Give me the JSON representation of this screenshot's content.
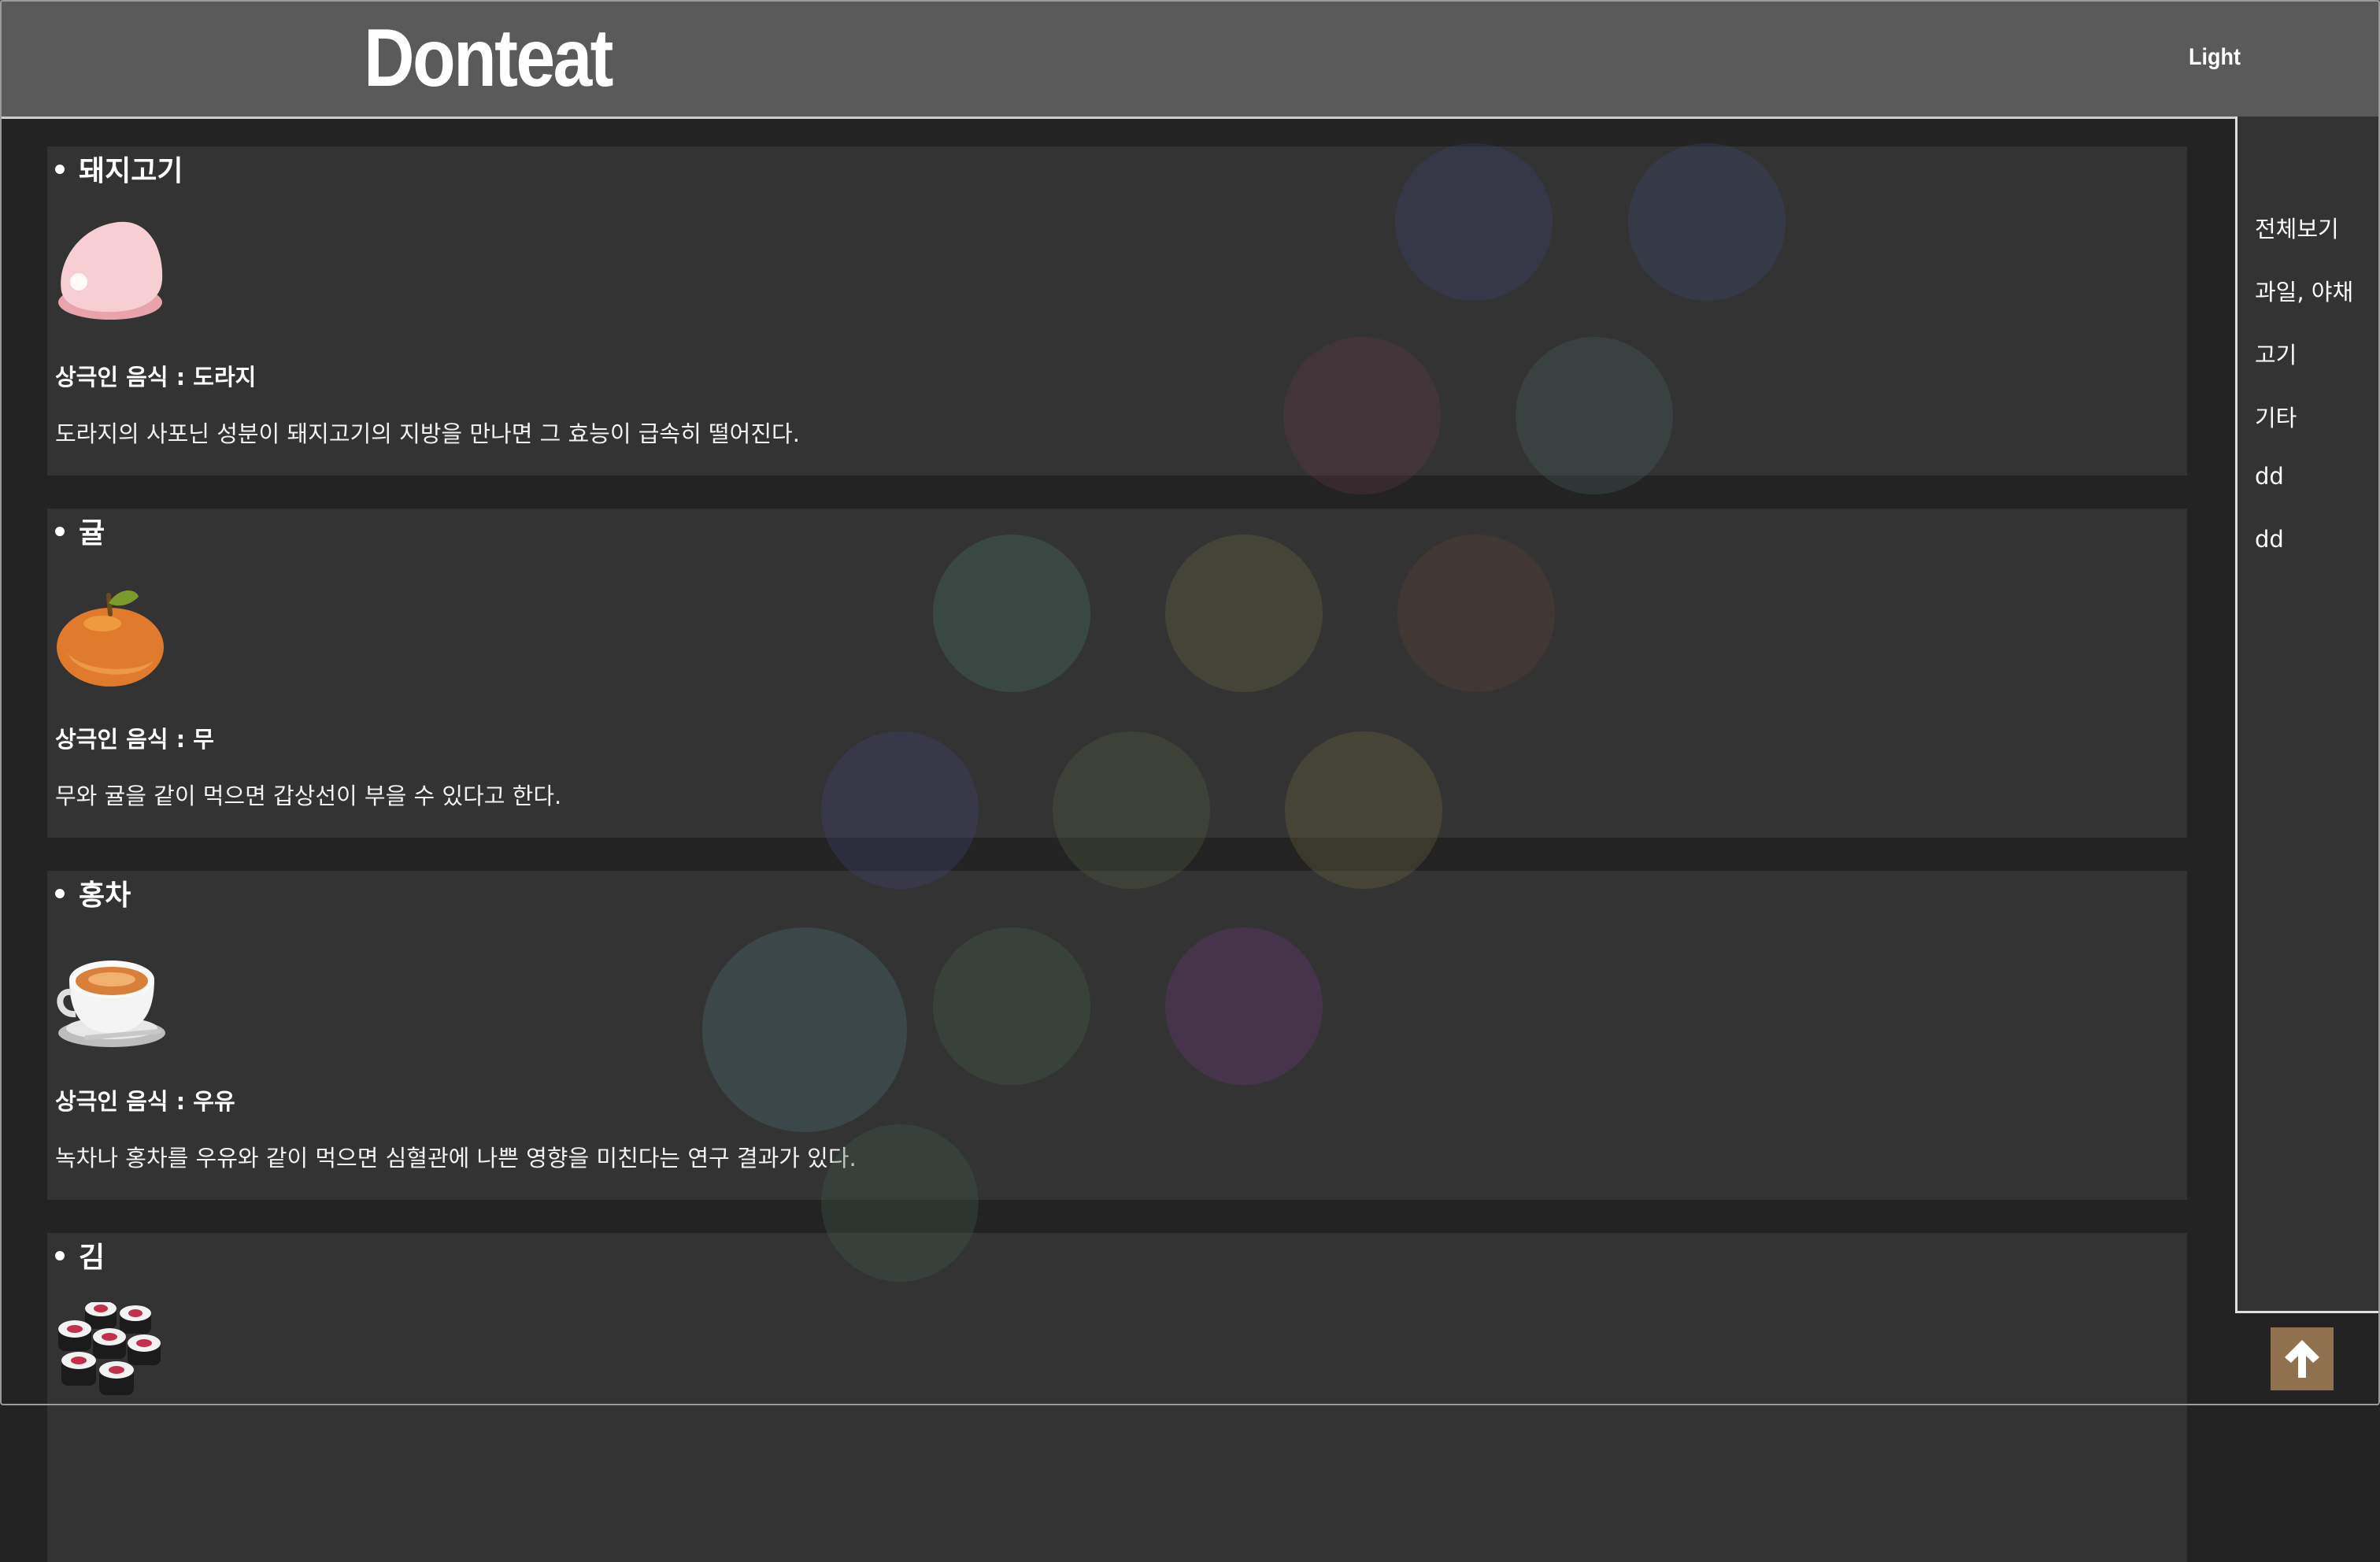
{
  "header": {
    "logo": "Donteat",
    "theme_toggle": "Light"
  },
  "sidebar": {
    "items": [
      {
        "label": "전체보기"
      },
      {
        "label": "과일, 야채"
      },
      {
        "label": "고기"
      },
      {
        "label": "기타"
      },
      {
        "label": "dd"
      },
      {
        "label": "dd"
      }
    ]
  },
  "foods": [
    {
      "name": "돼지고기",
      "icon": "pork-icon",
      "conflict": "상극인 음식 : 도라지",
      "description": "도라지의 사포닌 성분이 돼지고기의 지방을 만나면 그 효능이 급속히 떨어진다."
    },
    {
      "name": "귤",
      "icon": "tangerine-icon",
      "conflict": "상극인 음식 : 무",
      "description": "무와 귤을 같이 먹으면 갑상선이 부을 수 있다고 한다."
    },
    {
      "name": "홍차",
      "icon": "tea-cup-icon",
      "conflict": "상극인 음식 : 우유",
      "description": "녹차나 홍차를 우유와 같이 먹으면 심혈관에 나쁜 영향을 미친다는 연구 결과가 있다."
    },
    {
      "name": "김",
      "icon": "sushi-icon",
      "conflict": "",
      "description": ""
    }
  ],
  "top_button": {
    "icon": "arrow-up-icon",
    "color": "#8f7150"
  }
}
